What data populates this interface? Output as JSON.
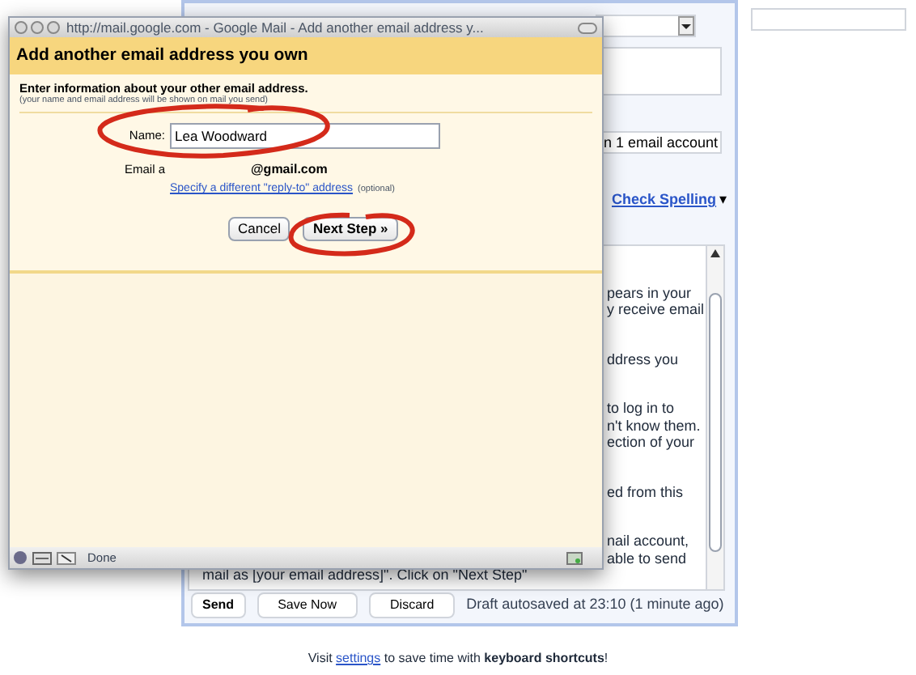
{
  "compose": {
    "account_field": "n 1 email account",
    "spell_check": "Check Spelling",
    "spell_caret": "▾",
    "paragraphs": [
      [
        {
          "text": "pears in your",
          "kind": "partial"
        },
        {
          "text": "y receive email",
          "kind": "partial"
        }
      ],
      [
        {
          "text": "ddress you",
          "kind": "partial"
        }
      ],
      [
        {
          "text": "to log in to",
          "kind": "partial"
        },
        {
          "text": "n't know them.",
          "kind": "partial"
        },
        {
          "text": "ection of your",
          "kind": "partial"
        }
      ],
      [
        {
          "text": "ed from this",
          "kind": "partial"
        }
      ],
      [
        {
          "text": "nail account,",
          "kind": "partial"
        },
        {
          "text": "able to send",
          "kind": "partial"
        },
        {
          "text": "mail as [your email address]\". Click on \"Next Step\"",
          "kind": "full"
        }
      ]
    ],
    "buttons": [
      "Send",
      "Save Now",
      "Discard"
    ],
    "draft_status": "Draft autosaved at 23:10 (1 minute ago)"
  },
  "popup": {
    "title_bar": "http://mail.google.com - Google Mail - Add another email address y...",
    "heading": "Add another email address you own",
    "intro": "Enter information about your other email address.",
    "note": "(your name and email address will be shown on mail you send)",
    "fields": [
      {
        "label": "Name:",
        "value": "Lea Woodward",
        "kind": "input"
      },
      {
        "label": "Email a",
        "value": "@gmail.com",
        "kind": "text"
      }
    ],
    "reply_to_link": "Specify a different \"reply-to\" address",
    "optional_note": "(optional)",
    "buttons": [
      {
        "label": "Cancel",
        "primary": false
      },
      {
        "label": "Next Step »",
        "primary": true
      }
    ],
    "status": "Done"
  },
  "footer": {
    "before": "Visit",
    "link": "settings",
    "after": "to save time with **keyboard shortcuts**!"
  }
}
